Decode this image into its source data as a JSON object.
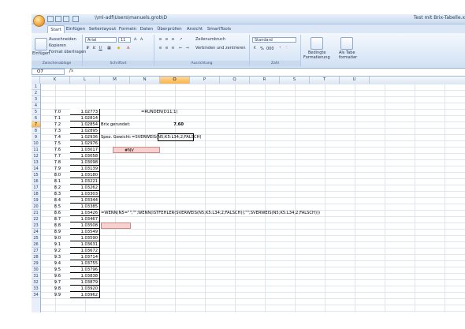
{
  "title_bar": {
    "path": "\\\\ml-adf\\Users\\manuels.grob\\D",
    "app_title": "Test mit Brix-Tabelle.x"
  },
  "tabs": [
    "Start",
    "Einfügen",
    "Seitenlayout",
    "Formeln",
    "Daten",
    "Überprüfen",
    "Ansicht",
    "SmartTools"
  ],
  "active_tab": "Start",
  "ribbon": {
    "clipboard": {
      "paste_label": "Einfügen",
      "cut_label": "Ausschneiden",
      "copy_label": "Kopieren",
      "format_painter_label": "Format übertragen",
      "group_label": "Zwischenablage"
    },
    "font": {
      "name": "Arial",
      "size": "11",
      "group_label": "Schriftart"
    },
    "alignment": {
      "wrap_label": "Zeilenumbruch",
      "merge_label": "Verbinden und zentrieren",
      "group_label": "Ausrichtung"
    },
    "number": {
      "format": "Standard",
      "percent": "%",
      "thousands": "000",
      "group_label": "Zahl"
    },
    "styles": {
      "conditional_label_1": "Bedingte",
      "conditional_label_2": "Formatierung",
      "table_label_1": "Als Tabe",
      "table_label_2": "formatier"
    }
  },
  "formula_bar": {
    "name_box": "O7",
    "fx": "fx",
    "formula": ""
  },
  "columns": [
    "K",
    "L",
    "M",
    "N",
    "O",
    "P",
    "Q",
    "R",
    "S",
    "T",
    "U"
  ],
  "selected_column": "O",
  "selected_row": 7,
  "row_count": 34,
  "cells": {
    "N3": "=RUNDEN(D11;1)",
    "M6": "Brix gerundet:",
    "O6": "7.60",
    "M8": "Spez. Gewicht:",
    "N8": "=SVERWEIS(N5;K5:L34;2;FALSCH)",
    "N10": "#NV",
    "M19": "=WENN(N5=\"\";\"\";WENN(ISTFEHLER(SVERWEIS(N5;K5:L34;2;FALSCH));\"\";SVERWEIS(N5;K5:L34;2;FALSCH)))"
  },
  "table_rows": [
    {
      "row": 5,
      "brix": "7.0",
      "sg": "1.02773"
    },
    {
      "row": 6,
      "brix": "7.1",
      "sg": "1.02814"
    },
    {
      "row": 7,
      "brix": "7.2",
      "sg": "1.02854"
    },
    {
      "row": 8,
      "brix": "7.3",
      "sg": "1.02895"
    },
    {
      "row": 9,
      "brix": "7.4",
      "sg": "1.02936"
    },
    {
      "row": 10,
      "brix": "7.5",
      "sg": "1.02976"
    },
    {
      "row": 11,
      "brix": "7.6",
      "sg": "1.03017"
    },
    {
      "row": 12,
      "brix": "7.7",
      "sg": "1.03058"
    },
    {
      "row": 13,
      "brix": "7.8",
      "sg": "1.03098"
    },
    {
      "row": 14,
      "brix": "7.9",
      "sg": "1.03139"
    },
    {
      "row": 15,
      "brix": "8.0",
      "sg": "1.03180"
    },
    {
      "row": 16,
      "brix": "8.1",
      "sg": "1.03221"
    },
    {
      "row": 17,
      "brix": "8.2",
      "sg": "1.03262"
    },
    {
      "row": 18,
      "brix": "8.3",
      "sg": "1.03303"
    },
    {
      "row": 19,
      "brix": "8.4",
      "sg": "1.03344"
    },
    {
      "row": 20,
      "brix": "8.5",
      "sg": "1.03385"
    },
    {
      "row": 21,
      "brix": "8.6",
      "sg": "1.03426"
    },
    {
      "row": 22,
      "brix": "8.7",
      "sg": "1.03467"
    },
    {
      "row": 23,
      "brix": "8.8",
      "sg": "1.03508"
    },
    {
      "row": 24,
      "brix": "8.9",
      "sg": "1.03549"
    },
    {
      "row": 25,
      "brix": "9.0",
      "sg": "1.03590"
    },
    {
      "row": 26,
      "brix": "9.1",
      "sg": "1.03631"
    },
    {
      "row": 27,
      "brix": "9.2",
      "sg": "1.03672"
    },
    {
      "row": 28,
      "brix": "9.3",
      "sg": "1.03714"
    },
    {
      "row": 29,
      "brix": "9.4",
      "sg": "1.03755"
    },
    {
      "row": 30,
      "brix": "9.5",
      "sg": "1.03796"
    },
    {
      "row": 31,
      "brix": "9.6",
      "sg": "1.03838"
    },
    {
      "row": 32,
      "brix": "9.7",
      "sg": "1.03879"
    },
    {
      "row": 33,
      "brix": "9.8",
      "sg": "1.03920"
    },
    {
      "row": 34,
      "brix": "9.9",
      "sg": "1.03962"
    }
  ],
  "colors": {
    "ribbon_blue": "#dbe8f7",
    "selection_orange": "#f9b54c",
    "error_pink": "#f6d1cf"
  }
}
